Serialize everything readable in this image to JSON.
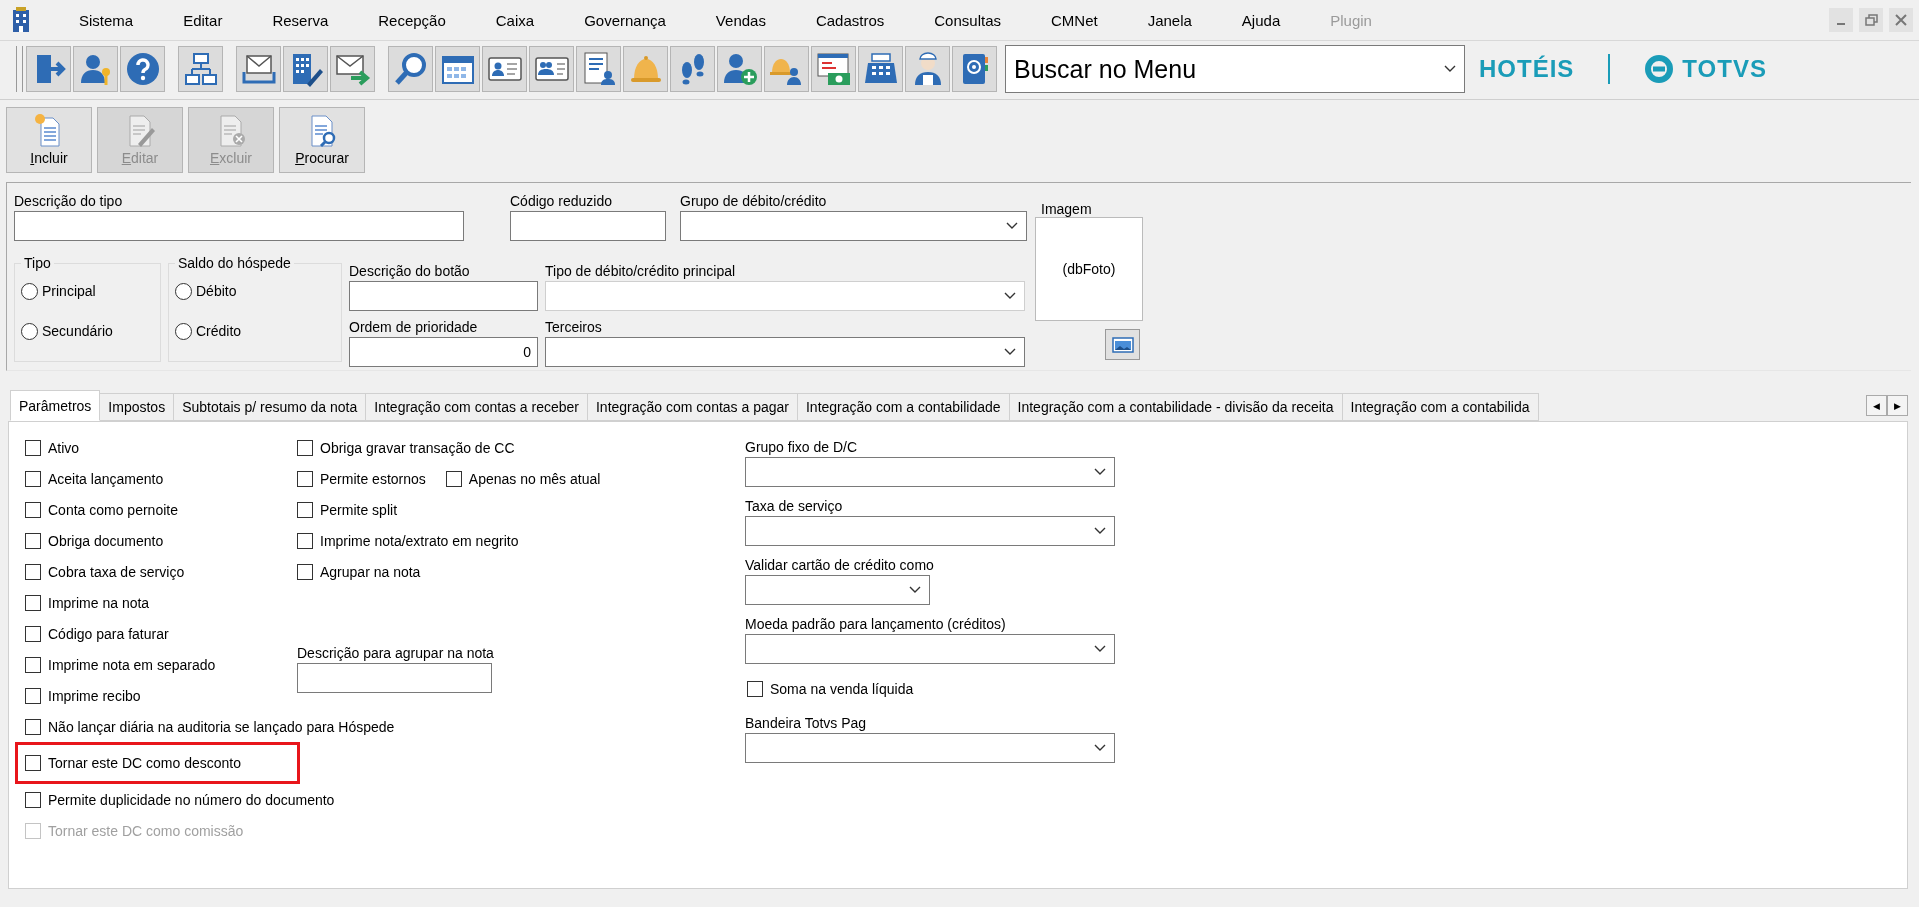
{
  "menu": [
    {
      "label": "Sistema",
      "disabled": false
    },
    {
      "label": "Editar",
      "disabled": false
    },
    {
      "label": "Reserva",
      "disabled": false
    },
    {
      "label": "Recepção",
      "disabled": false
    },
    {
      "label": "Caixa",
      "disabled": false
    },
    {
      "label": "Governança",
      "disabled": false
    },
    {
      "label": "Vendas",
      "disabled": false
    },
    {
      "label": "Cadastros",
      "disabled": false
    },
    {
      "label": "Consultas",
      "disabled": false
    },
    {
      "label": "CMNet",
      "disabled": false
    },
    {
      "label": "Janela",
      "disabled": false
    },
    {
      "label": "Ajuda",
      "disabled": false
    },
    {
      "label": "Plugin",
      "disabled": true
    }
  ],
  "search_combo": {
    "value": "Buscar no Menu"
  },
  "logo": {
    "product": "HOTÉIS",
    "company": "TOTVS"
  },
  "actions": [
    {
      "label": "Incluir",
      "kind": "new",
      "disabled": false
    },
    {
      "label": "Editar",
      "kind": "edit",
      "disabled": true
    },
    {
      "label": "Excluir",
      "kind": "delete",
      "disabled": true
    },
    {
      "label": "Procurar",
      "kind": "find",
      "disabled": false
    }
  ],
  "form": {
    "description": {
      "label": "Descrição do tipo"
    },
    "short_code": {
      "label": "Código reduzido"
    },
    "group": {
      "label": "Grupo de débito/crédito",
      "disabled": false
    },
    "image": {
      "title": "Imagem",
      "content": "(dbFoto)"
    },
    "type_group": {
      "title": "Tipo",
      "options": [
        {
          "label": "Principal",
          "selected": false
        },
        {
          "label": "Secundário",
          "selected": false
        }
      ]
    },
    "balance_group": {
      "title": "Saldo do hóspede",
      "options": [
        {
          "label": "Débito",
          "selected": false
        },
        {
          "label": "Crédito",
          "selected": false
        }
      ]
    },
    "button_description": {
      "label": "Descrição do botão"
    },
    "main_type": {
      "label": "Tipo de débito/crédito principal",
      "disabled": true
    },
    "priority": {
      "label": "Ordem de prioridade",
      "value": "0"
    },
    "third_parties": {
      "label": "Terceiros",
      "disabled": false
    }
  },
  "tabs": [
    {
      "label": "Parâmetros",
      "selected": true
    },
    {
      "label": "Impostos",
      "selected": false
    },
    {
      "label": "Subtotais p/ resumo da nota",
      "selected": false
    },
    {
      "label": "Integração com contas a receber",
      "selected": false
    },
    {
      "label": "Integração com contas a pagar",
      "selected": false
    },
    {
      "label": "Integração com a contabilidade",
      "selected": false
    },
    {
      "label": "Integração com a contabilidade - divisão da receita",
      "selected": false
    },
    {
      "label": "Integração com a contabilida",
      "selected": false
    }
  ],
  "tab_scroll": [
    "◀",
    "▶"
  ],
  "parameters": {
    "left": [
      {
        "label": "Ativo",
        "checked": false,
        "disabled": false,
        "highlighted": false
      },
      {
        "label": "Aceita lançamento",
        "checked": false,
        "disabled": false,
        "highlighted": false
      },
      {
        "label": "Conta como pernoite",
        "checked": false,
        "disabled": false,
        "highlighted": false
      },
      {
        "label": "Obriga documento",
        "checked": false,
        "disabled": false,
        "highlighted": false
      },
      {
        "label": "Cobra taxa de serviço",
        "checked": false,
        "disabled": false,
        "highlighted": false
      },
      {
        "label": "Imprime na nota",
        "checked": false,
        "disabled": false,
        "highlighted": false
      },
      {
        "label": "Código para faturar",
        "checked": false,
        "disabled": false,
        "highlighted": false
      },
      {
        "label": "Imprime nota em separado",
        "checked": false,
        "disabled": false,
        "highlighted": false
      },
      {
        "label": "Imprime recibo",
        "checked": false,
        "disabled": false,
        "highlighted": false
      },
      {
        "label": "Não lançar diária na auditoria se lançado para Hóspede",
        "checked": false,
        "disabled": false,
        "highlighted": false
      },
      {
        "label": "Tornar este DC como desconto",
        "checked": false,
        "disabled": false,
        "highlighted": true
      },
      {
        "label": "Permite duplicidade no número do documento",
        "checked": false,
        "disabled": false,
        "highlighted": false
      },
      {
        "label": "Tornar este DC como comissão",
        "checked": false,
        "disabled": true,
        "highlighted": false
      }
    ],
    "middle": [
      {
        "label": "Obriga gravar transação de CC",
        "checked": false
      },
      {
        "label": "Permite estornos",
        "checked": false,
        "extra": {
          "label": "Apenas no mês atual",
          "checked": false
        }
      },
      {
        "label": "Permite split",
        "checked": false
      },
      {
        "label": "Imprime nota/extrato em negrito",
        "checked": false
      },
      {
        "label": "Agrupar na nota",
        "checked": false
      }
    ],
    "grouping_field": {
      "label": "Descrição para agrupar na nota"
    },
    "right": [
      {
        "kind": "select",
        "label": "Grupo fixo de D/C"
      },
      {
        "kind": "select",
        "label": "Taxa de serviço"
      },
      {
        "kind": "short-select",
        "label": "Validar cartão de crédito como"
      },
      {
        "kind": "select",
        "label": "Moeda padrão para lançamento (créditos)"
      },
      {
        "kind": "checkbox",
        "label": "Soma na venda líquida",
        "checked": false
      },
      {
        "kind": "select",
        "label": "Bandeira Totvs Pag"
      }
    ]
  }
}
